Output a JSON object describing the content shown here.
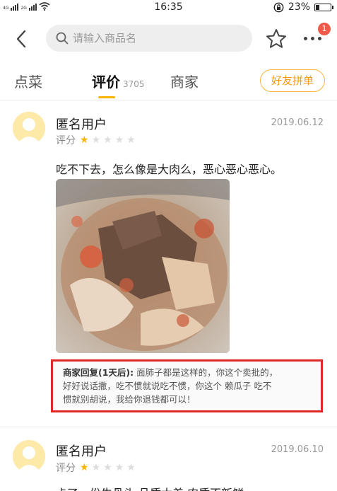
{
  "status_bar": {
    "network_left": "4G",
    "network_right": "2G",
    "time": "16:35",
    "battery": "23%"
  },
  "nav": {
    "search_placeholder": "请输入商品名",
    "more_badge": "1"
  },
  "tabs": {
    "dishes": "点菜",
    "reviews": "评价",
    "reviews_count": "3705",
    "merchant": "商家",
    "friend_order": "好友拼单"
  },
  "reviews": [
    {
      "username": "匿名用户",
      "date": "2019.06.12",
      "rating_label": "评分",
      "stars": 1,
      "text": "吃不下去，怎么像是大肉么，恶心恶心恶心。",
      "reply_label": "商家回复(1天后):",
      "reply_line1": " 面肺子都是这样的，你这个卖批的，",
      "reply_line2": "好好说话撒，吃不惯就说吃不惯，你这个 赖瓜子 吃不",
      "reply_line3": "惯就别胡说，我给你退钱都可以！"
    },
    {
      "username": "匿名用户",
      "date": "2019.06.10",
      "rating_label": "评分",
      "stars": 1,
      "text": "卡了一份牛骨头 品质太差 肉质不新鲜"
    }
  ],
  "icons": {
    "back": "chevron-left-icon",
    "search": "search-icon",
    "favorite": "star-outline-icon",
    "more": "more-dots-icon",
    "wifi": "wifi-icon",
    "lock_rotation": "rotation-lock-icon",
    "battery": "battery-icon"
  },
  "colors": {
    "accent": "#f8b500",
    "reply_border": "#e02828",
    "badge": "#f05a4a"
  }
}
